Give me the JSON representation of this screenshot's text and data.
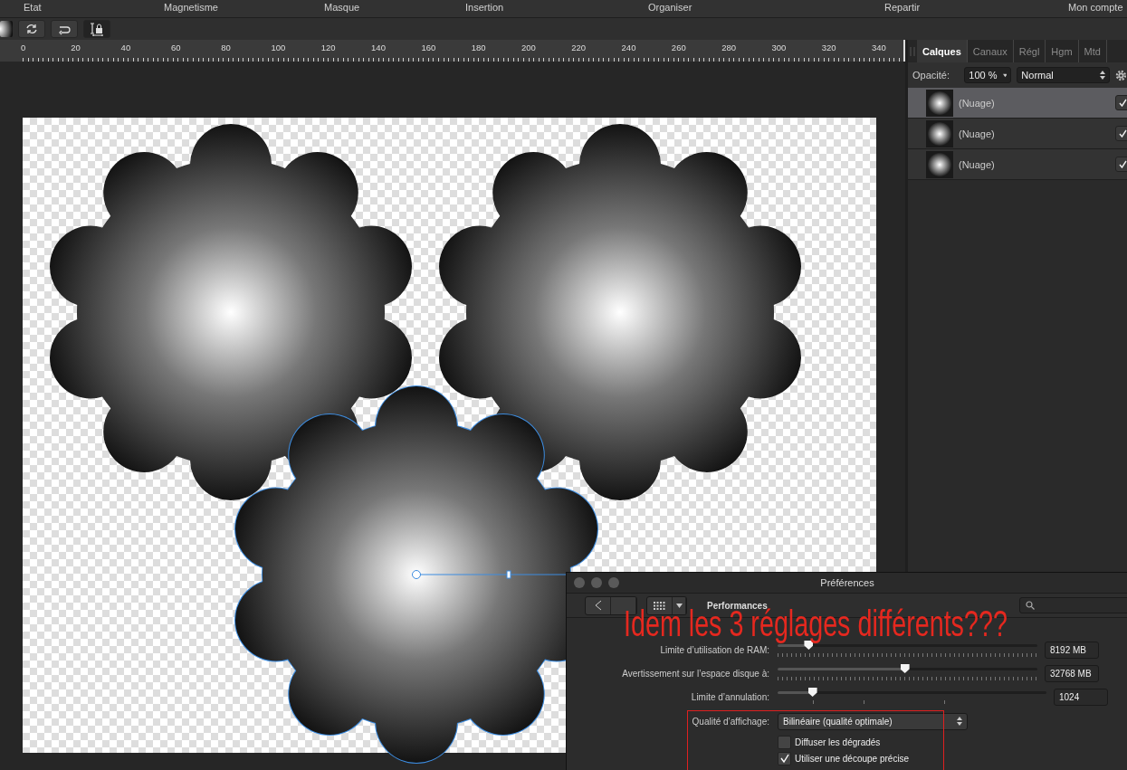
{
  "menu": [
    "Etat",
    "Magnetisme",
    "Masque",
    "Insertion",
    "Organiser",
    "Repartir",
    "Mon compte"
  ],
  "ruler": {
    "ticks": [
      "0",
      "20",
      "40",
      "60",
      "80",
      "100",
      "120",
      "140",
      "160",
      "180",
      "200",
      "220",
      "240",
      "260",
      "280",
      "300",
      "320",
      "340"
    ]
  },
  "panel": {
    "tabs": [
      {
        "label": "Calques",
        "selected": true
      },
      {
        "label": "Canaux",
        "selected": false
      },
      {
        "label": "Régl",
        "selected": false
      },
      {
        "label": "Hgm",
        "selected": false
      },
      {
        "label": "Mtd",
        "selected": false
      }
    ],
    "opacity_label": "Opacité:",
    "opacity": "100 %",
    "blend_mode": "Normal",
    "layers": [
      {
        "name": "(Nuage)",
        "selected": true,
        "visible": true
      },
      {
        "name": "(Nuage)",
        "selected": false,
        "visible": true
      },
      {
        "name": "(Nuage)",
        "selected": false,
        "visible": true
      }
    ]
  },
  "canvas": {
    "shapes": [
      {
        "selected": false
      },
      {
        "selected": false
      },
      {
        "selected": true
      }
    ]
  },
  "preferences": {
    "title": "Préférences",
    "section": "Performances",
    "settings": [
      {
        "kind": "slider",
        "label": "Limite d’utilisation de RAM:",
        "level": 0.12,
        "value": "8192 MB"
      },
      {
        "kind": "slider",
        "label": "Avertissement sur l’espace disque à:",
        "level": 0.49,
        "value": "32768 MB"
      },
      {
        "kind": "stepped-slider",
        "label": "Limite d’annulation:",
        "level": 0.13,
        "value": "1024"
      },
      {
        "kind": "select",
        "label": "Qualité d’affichage:",
        "value": "Bilinéaire (qualité optimale)"
      },
      {
        "kind": "checkbox",
        "label": "Diffuser les dégradés",
        "checked": false
      },
      {
        "kind": "checkbox",
        "label": "Utiliser une découpe précise",
        "checked": true
      }
    ]
  },
  "annotation": {
    "text": "Idem les 3 réglages différents???"
  }
}
